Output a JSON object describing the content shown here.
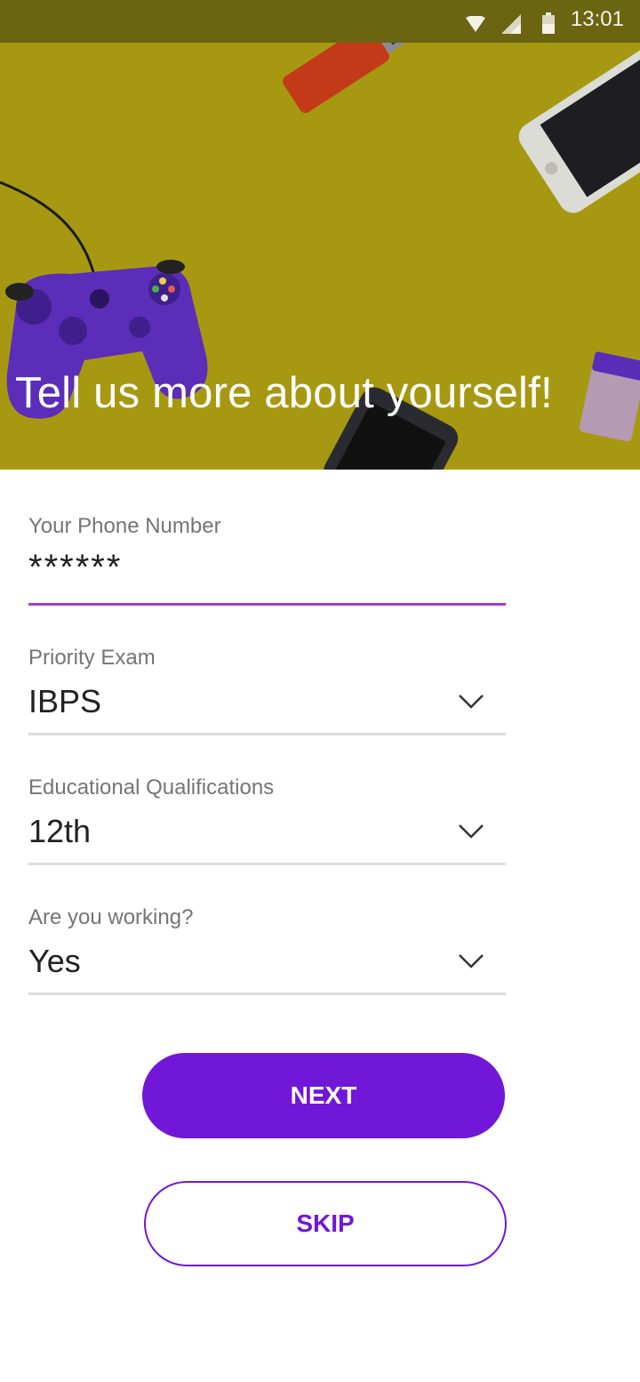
{
  "status_bar": {
    "time": "13:01",
    "icons": [
      "wifi-icon",
      "signal-icon",
      "battery-icon"
    ]
  },
  "hero": {
    "title": "Tell us more about yourself!"
  },
  "form": {
    "phone": {
      "label": "Your Phone Number",
      "value": "******"
    },
    "priority_exam": {
      "label": "Priority Exam",
      "value": "IBPS"
    },
    "education": {
      "label": "Educational Qualifications",
      "value": "12th"
    },
    "working": {
      "label": "Are you working?",
      "value": "Yes"
    }
  },
  "buttons": {
    "next": "NEXT",
    "skip": "SKIP"
  },
  "colors": {
    "accent": "#7117d8",
    "hero_bg": "#a79812",
    "active_underline": "#9c3fd6"
  }
}
